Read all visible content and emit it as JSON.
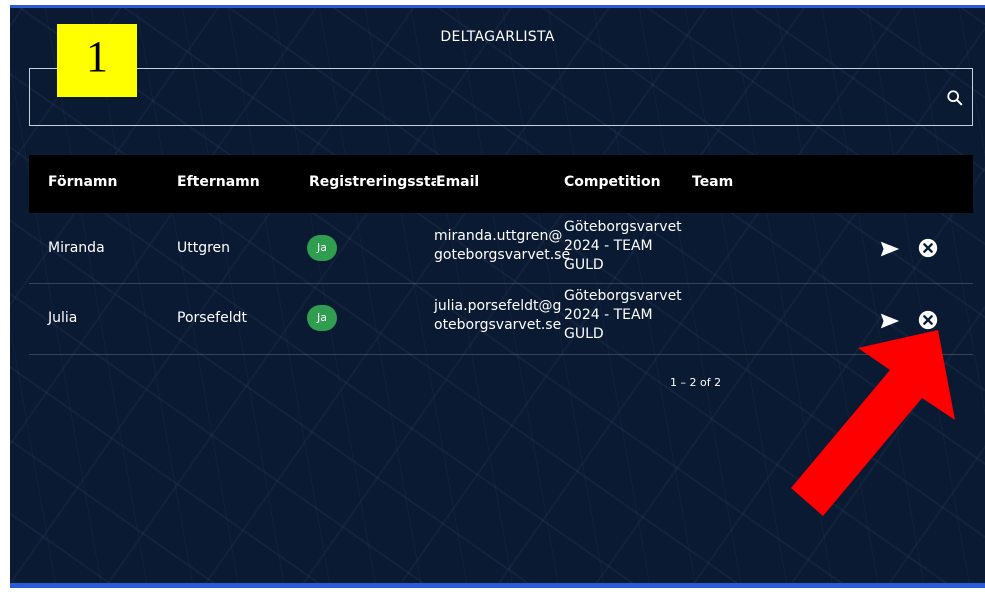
{
  "page_title": "DELTAGARLISTA",
  "step_badge": "1",
  "search": {
    "placeholder": "",
    "icon": "search-icon"
  },
  "table": {
    "columns": [
      "Förnamn",
      "Efternamn",
      "Registreringsstatus",
      "Email",
      "Competition",
      "Team"
    ],
    "rows": [
      {
        "first_name": "Miranda",
        "last_name": "Uttgren",
        "status": "Ja",
        "email_l1": "miranda.uttgren@",
        "email_l2": "goteborgsvarvet.se",
        "comp_l1": "Göteborgsvarvet",
        "comp_l2": "2024 - TEAM",
        "comp_l3": "GULD",
        "team": ""
      },
      {
        "first_name": "Julia",
        "last_name": "Porsefeldt",
        "status": "Ja",
        "email_l1": "julia.porsefeldt@g",
        "email_l2": "oteborgsvarvet.se",
        "comp_l1": "Göteborgsvarvet",
        "comp_l2": "2024 - TEAM",
        "comp_l3": "GULD",
        "team": ""
      }
    ],
    "row_actions": [
      "send-icon",
      "remove-icon"
    ]
  },
  "pagination": "1 – 2 of 2",
  "colors": {
    "background": "#0b1a33",
    "header_bg": "#000000",
    "status_ok": "#2f9e4f",
    "badge": "#ffff00",
    "arrow": "#ff0000",
    "accent_line": "#2a5bd7"
  }
}
